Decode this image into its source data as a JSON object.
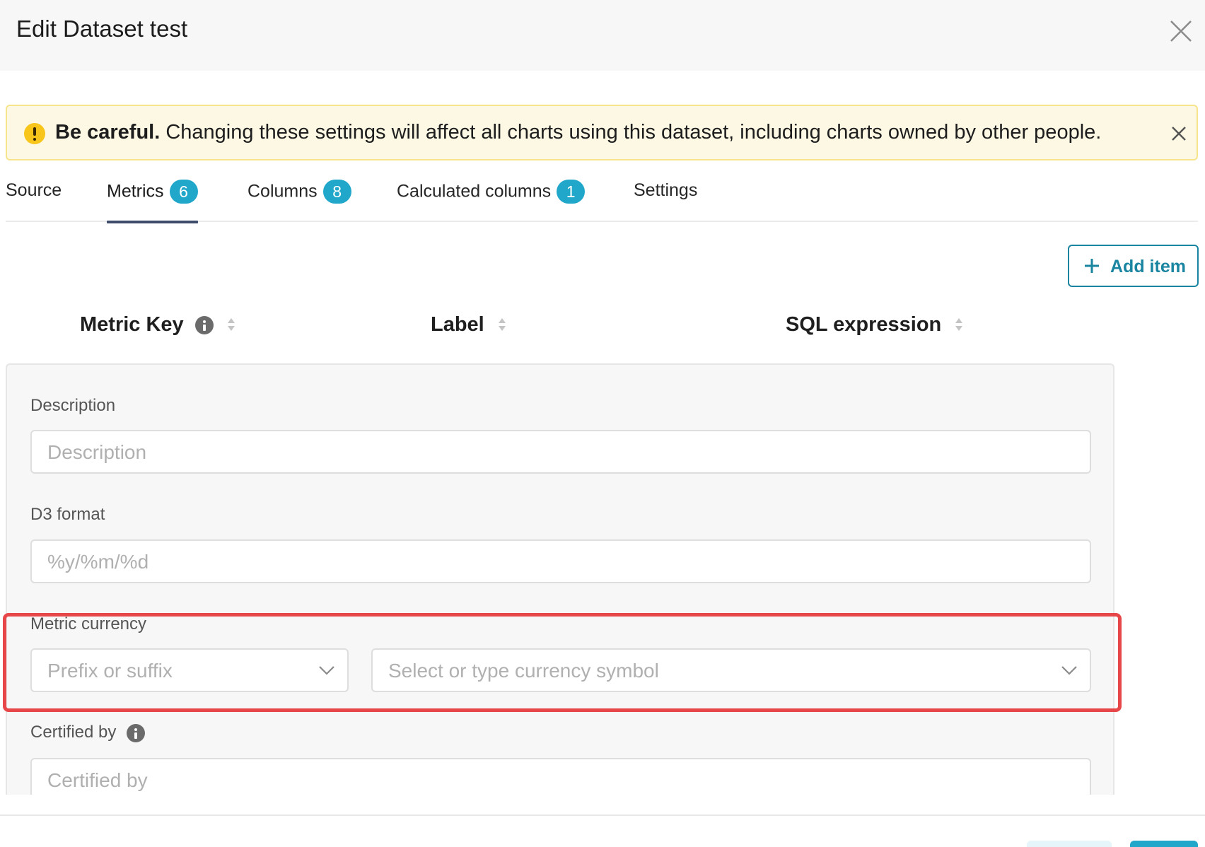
{
  "header": {
    "title": "Edit Dataset test"
  },
  "alert": {
    "strong": "Be careful.",
    "message": " Changing these settings will affect all charts using this dataset, including charts owned by other people."
  },
  "tabs": [
    {
      "label": "Source"
    },
    {
      "label": "Metrics",
      "count": "6",
      "active": true
    },
    {
      "label": "Columns",
      "count": "8"
    },
    {
      "label": "Calculated columns",
      "count": "1"
    },
    {
      "label": "Settings"
    }
  ],
  "toolbar": {
    "add_item_label": "Add item"
  },
  "table": {
    "headers": [
      "Metric Key",
      "Label",
      "SQL expression"
    ]
  },
  "panel": {
    "description_label": "Description",
    "description_placeholder": "Description",
    "d3_label": "D3 format",
    "d3_placeholder": "%y/%m/%d",
    "currency_label": "Metric currency",
    "currency_position_placeholder": "Prefix or suffix",
    "currency_symbol_placeholder": "Select or type currency symbol",
    "certified_label": "Certified by",
    "certified_placeholder": "Certified by"
  },
  "colors": {
    "accent": "#20a7c9",
    "button_primary": "#1a85a0",
    "highlight": "#e8474a",
    "warning_bg": "#fdf8e3",
    "warning_icon": "#f8c51b",
    "active_tab_underline": "#3e4b6b"
  },
  "icons": [
    "close-icon",
    "warning-icon",
    "plus-icon",
    "info-icon",
    "sort-icon",
    "chevron-down-icon"
  ]
}
